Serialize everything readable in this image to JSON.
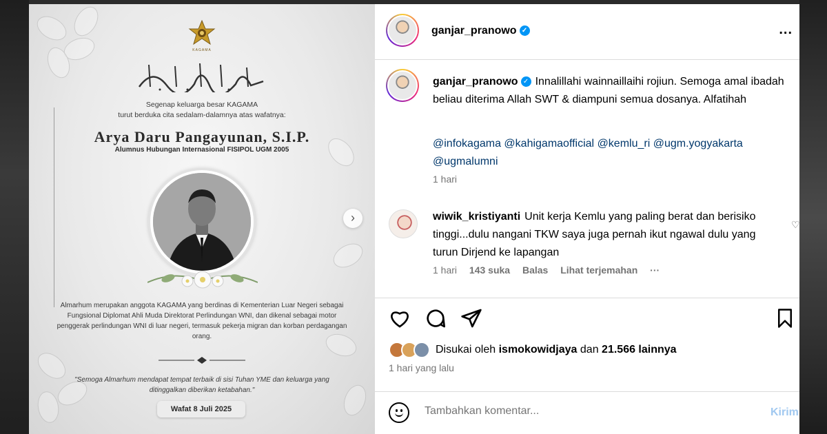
{
  "poster": {
    "logo_text": "KAGAMA",
    "line1": "Segenap keluarga besar KAGAMA",
    "line2": "turut berduka cita sedalam-dalamnya atas wafatnya:",
    "name": "Arya Daru Pangayunan, S.I.P.",
    "alumni": "Alumnus Hubungan Internasional FISIPOL UGM 2005",
    "body": "Almarhum merupakan anggota KAGAMA yang berdinas di Kementerian Luar Negeri sebagai Fungsional Diplomat Ahli Muda Direktorat Perlindungan WNI, dan dikenal sebagai motor penggerak perlindungan WNI di luar negeri, termasuk pekerja migran dan korban perdagangan orang.",
    "quote": "\"Semoga Almarhum mendapat tempat terbaik di sisi Tuhan YME dan keluarga yang ditinggalkan diberikan ketabahan.\"",
    "wafat": "Wafat 8 Juli 2025"
  },
  "header": {
    "username": "ganjar_pranowo",
    "verified_icon": "✓",
    "more": "..."
  },
  "caption": {
    "username": "ganjar_pranowo",
    "text": "Innalillahi wainnaillaihi rojiun. Semoga amal ibadah beliau diterima Allah SWT & diampuni semua dosanya. Alfatihah",
    "tags": [
      "@infokagama",
      "@kahigamaofficial",
      "@kemlu_ri",
      "@ugm.yogyakarta",
      "@ugmalumni"
    ],
    "time": "1 hari"
  },
  "comment": {
    "username": "wiwik_kristiyanti",
    "text": "Unit kerja Kemlu yang paling berat dan berisiko tinggi...dulu nangani TKW saya juga pernah ikut ngawal dulu yang turun Dirjend ke lapangan",
    "time": "1 hari",
    "likes": "143 suka",
    "reply": "Balas",
    "translate": "Lihat terjemahan",
    "more": "···"
  },
  "likes": {
    "prefix": "Disukai oleh",
    "user": "ismokowidjaya",
    "mid": "dan",
    "count": "21.566 lainnya"
  },
  "posted_ago": "1 hari yang lalu",
  "add_comment": {
    "placeholder": "Tambahkan komentar...",
    "post": "Kirim"
  },
  "colors": {
    "link": "#00376b",
    "verified": "#0095f6",
    "muted": "#737373"
  }
}
